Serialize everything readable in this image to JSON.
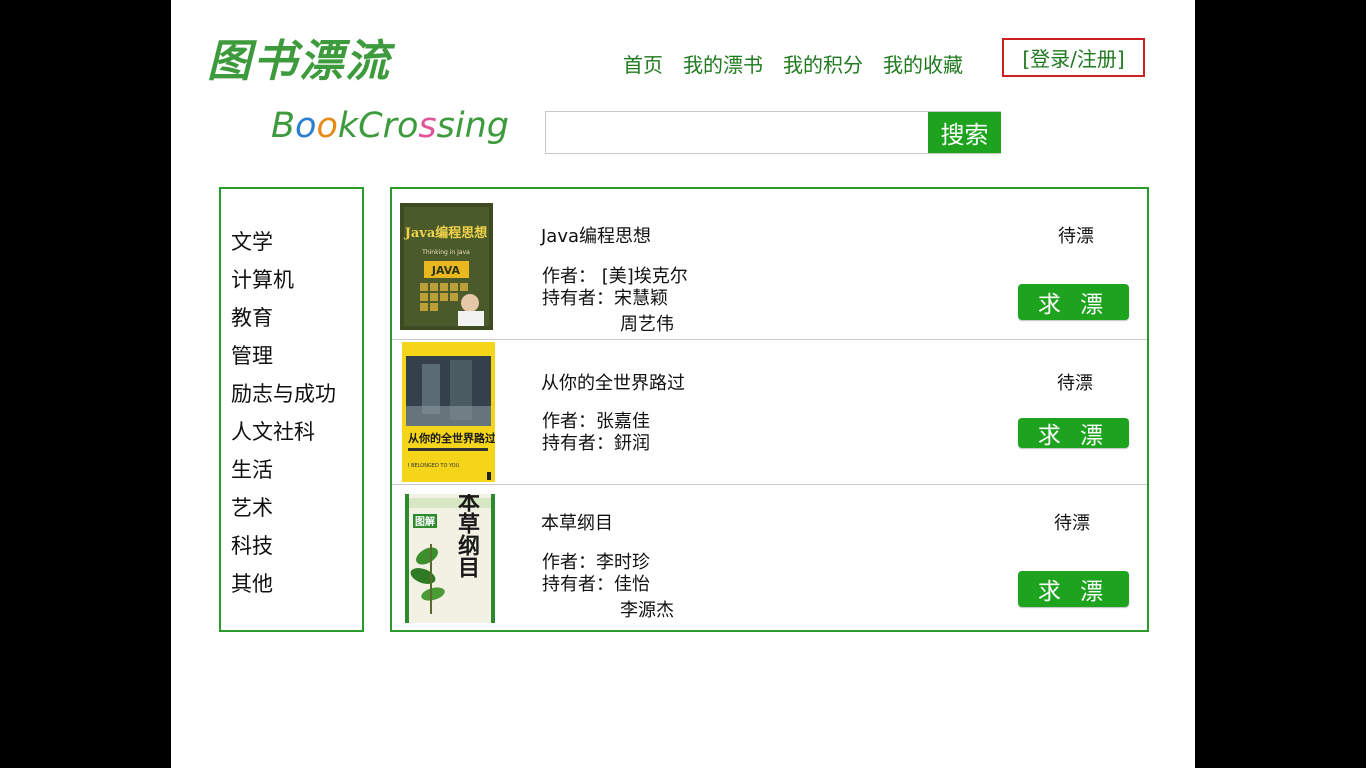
{
  "logo": {
    "cn": "图书漂流",
    "en_parts": [
      "B",
      "o",
      "o",
      "kCro",
      "s",
      "sing"
    ]
  },
  "nav": {
    "items": [
      "首页",
      "我的漂书",
      "我的积分",
      "我的收藏"
    ],
    "login": "[登录/注册]"
  },
  "search": {
    "value": "",
    "placeholder": "",
    "button": "搜索"
  },
  "categories": [
    "文学",
    "计算机",
    "教育",
    "管理",
    "励志与成功",
    "人文社科",
    "生活",
    "艺术",
    "科技",
    "其他"
  ],
  "books": [
    {
      "title": "Java编程思想",
      "author_label": "作者：",
      "author": "[美]埃克尔",
      "holder_label": "持有者：",
      "holders": [
        "宋慧颖",
        "周艺伟"
      ],
      "status": "待漂",
      "button": "求 漂",
      "cover": {
        "top_text": "Java编程思想",
        "sub_text": "Thinking in Java",
        "badge": "JAVA",
        "bg": "#3e4a22",
        "badge_bg": "#e8b81e"
      }
    },
    {
      "title": "从你的全世界路过",
      "author_label": "作者：",
      "author": "张嘉佳",
      "holder_label": "持有者：",
      "holders": [
        "鈃润"
      ],
      "status": "待漂",
      "button": "求 漂",
      "cover": {
        "top_text": "从你的全世界路过",
        "sub_text": "I BELONGED TO YOU",
        "bg": "#f4d51a"
      }
    },
    {
      "title": "本草纲目",
      "author_label": "作者：",
      "author": "李时珍",
      "holder_label": "持有者：",
      "holders": [
        "佳怡",
        "李源杰"
      ],
      "status": "待漂",
      "button": "求 漂",
      "cover": {
        "top_text": "本草纲目",
        "badge": "图解",
        "bg": "#f3f1e4",
        "accent": "#2f8a2f"
      }
    }
  ],
  "colors": {
    "brand_green": "#1ea31e",
    "border_green": "#2a9a2a",
    "login_border": "#cc1f1f"
  }
}
